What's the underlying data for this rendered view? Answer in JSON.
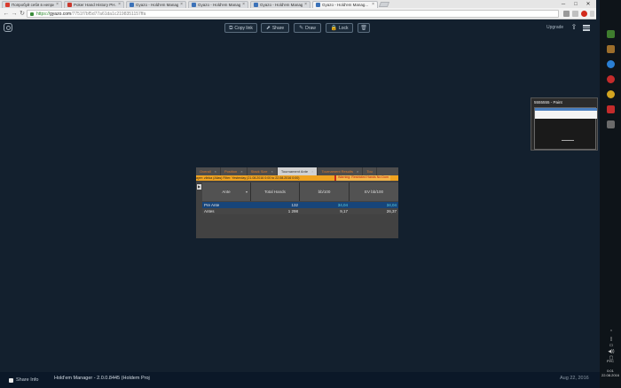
{
  "browser": {
    "tabs": [
      {
        "title": "Попробуй себя в неприв...",
        "fav": "#d93b2e"
      },
      {
        "title": "Poker Hand History PH...",
        "fav": "#c9372c"
      },
      {
        "title": "Gyazo - Hold'em Manag...",
        "fav": "#3c72b8"
      },
      {
        "title": "Gyazo - Hold'em Manag...",
        "fav": "#3c72b8"
      },
      {
        "title": "Gyazo - Hold'em Manag...",
        "fav": "#3c72b8"
      },
      {
        "title": "Gyazo - Hold'em Manag...",
        "fav": "#3c72b8"
      }
    ],
    "close_glyph": "×",
    "win_min": "─",
    "win_max": "□",
    "win_close": "✕",
    "url_scheme": "https://",
    "url_host": "gyazo.com",
    "url_path": "/7751f7bf5d77a61da1c2198351157ffa",
    "back_glyph": "←",
    "fwd_glyph": "→",
    "reload_glyph": "↻",
    "ext_colors": [
      "#9a9a9a",
      "#c0c0c0",
      "#d22a1c",
      "#d0d0d0"
    ]
  },
  "gyazo": {
    "copy_link": "Copy link",
    "share": "Share",
    "draw": "Draw",
    "lock": "Lock",
    "upgrade": "Upgrade",
    "icons": {
      "copy": "⧉",
      "share": "⬈",
      "draw": "✎",
      "lock": "🔒",
      "delete": "🗑",
      "upload": "⇪"
    }
  },
  "screenshot": {
    "tabs": [
      "Overall",
      "Position",
      "Stack Size",
      "Tournament Ante",
      "Tournament Results",
      "Tou"
    ],
    "active_tab": 3,
    "filter_text": "ayer: zlinka (Alias)   Filter: Yesterday (21.08.2016 0:00 to 22.08.2016 0:00)",
    "warning_text": "Warning: Restricted Hands   No Dom",
    "side_icon": "▶",
    "columns": [
      "Ante",
      "Total Hands",
      "bb/100",
      "EV bb/100"
    ],
    "rows": [
      [
        "Pre Ante",
        "132",
        "34,04",
        "34,04"
      ],
      [
        "Antes",
        "1 298",
        "9,17",
        "26,37"
      ]
    ]
  },
  "thumbnail": {
    "title": "5555555 - Paint"
  },
  "taskbar": {
    "icon_colors": [
      "#3f7d2e",
      "#9c6e2b",
      "#2a7fd4",
      "#c42b2b",
      "#d4a520",
      "#c42b2b",
      "#6a6a6a"
    ],
    "tray_up": "⌃",
    "tray_items": [
      "▯",
      "▭",
      "◀))",
      "▢"
    ],
    "lang": "РУС",
    "time": "0:01",
    "date": "22.08.2016"
  },
  "footer": {
    "share_info": "Share Info",
    "app_title": "Hold'em Manager - 2.0.0.8445 (Holdem Proj",
    "date": "Aug 22, 2016"
  }
}
